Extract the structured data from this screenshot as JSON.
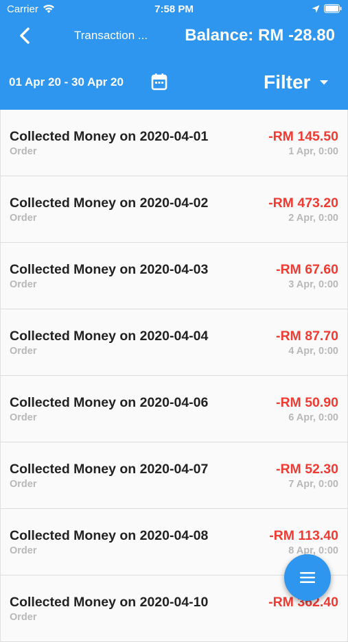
{
  "status_bar": {
    "carrier": "Carrier",
    "time": "7:58 PM"
  },
  "header": {
    "title": "Transaction ...",
    "balance": "Balance: RM -28.80",
    "date_range": "01 Apr 20 - 30 Apr 20",
    "filter_label": "Filter"
  },
  "colors": {
    "primary": "#2e96ef",
    "negative_amount": "#ef3b33",
    "muted_text": "#b8b8b8"
  },
  "transactions": [
    {
      "title": "Collected Money on 2020-04-01",
      "type": "Order",
      "amount": "-RM 145.50",
      "date": "1 Apr, 0:00"
    },
    {
      "title": "Collected Money on 2020-04-02",
      "type": "Order",
      "amount": "-RM 473.20",
      "date": "2 Apr, 0:00"
    },
    {
      "title": "Collected Money on 2020-04-03",
      "type": "Order",
      "amount": "-RM 67.60",
      "date": "3 Apr, 0:00"
    },
    {
      "title": "Collected Money on 2020-04-04",
      "type": "Order",
      "amount": "-RM 87.70",
      "date": "4 Apr, 0:00"
    },
    {
      "title": "Collected Money on 2020-04-06",
      "type": "Order",
      "amount": "-RM 50.90",
      "date": "6 Apr, 0:00"
    },
    {
      "title": "Collected Money on 2020-04-07",
      "type": "Order",
      "amount": "-RM 52.30",
      "date": "7 Apr, 0:00"
    },
    {
      "title": "Collected Money on 2020-04-08",
      "type": "Order",
      "amount": "-RM 113.40",
      "date": "8 Apr, 0:00"
    },
    {
      "title": "Collected Money on 2020-04-10",
      "type": "Order",
      "amount": "-RM 362.40",
      "date": ""
    }
  ],
  "fab": {
    "icon": "menu-icon"
  }
}
